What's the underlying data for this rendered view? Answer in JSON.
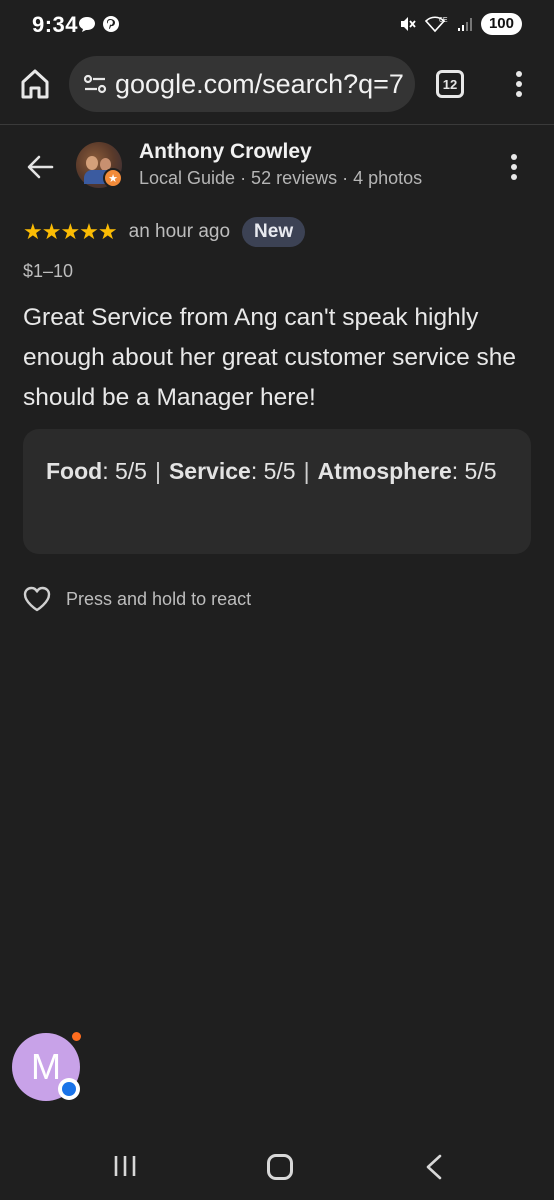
{
  "status_bar": {
    "time": "9:34",
    "battery": "100",
    "icons_left": [
      "chat-bubble-icon",
      "pinterest-icon"
    ],
    "icons_right": [
      "mute-icon",
      "wifi-6e-icon",
      "signal-icon"
    ]
  },
  "browser": {
    "url": "google.com/search?q=7",
    "tab_count": "12"
  },
  "reviewer": {
    "name": "Anthony Crowley",
    "meta": "Local Guide · 52 reviews · 4 photos"
  },
  "review": {
    "stars": "★★★★★",
    "rating": 5,
    "time_ago": "an hour ago",
    "badge": "New",
    "price": "$1–10",
    "text": "Great Service from Ang can't speak highly enough about her great customer service she should be a Manager here!",
    "ratings": {
      "food_label": "Food",
      "food_value": ": 5/5",
      "service_label": "Service",
      "service_value": ": 5/5",
      "atmosphere_label": "Atmosphere",
      "atmosphere_value": ": 5/5",
      "separator": "|"
    },
    "react_text": "Press and hold to react"
  },
  "profile": {
    "initial": "M"
  },
  "colors": {
    "background": "#1f1f1f",
    "star": "#fbbc04",
    "badge_bg": "#3c4254",
    "local_guide": "#f28b3a"
  }
}
